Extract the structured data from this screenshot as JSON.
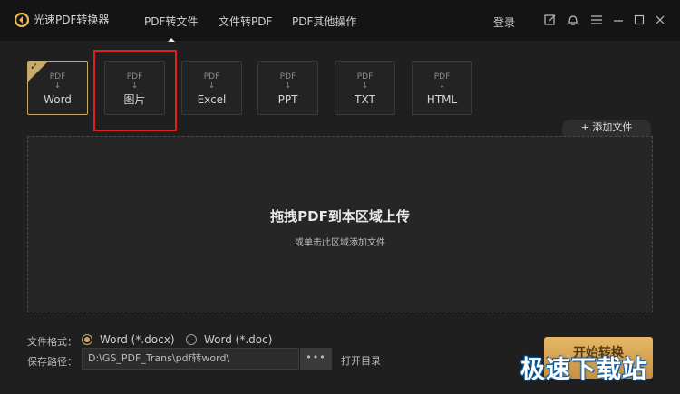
{
  "app": {
    "title": "光速PDF转换器",
    "colors": {
      "accent": "#c9a969",
      "background": "#1f1f1f",
      "titlebar": "#141414",
      "highlight": "#e02020",
      "start": "#e6b766"
    }
  },
  "nav": {
    "tabs": [
      {
        "label": "PDF转文件",
        "active": true
      },
      {
        "label": "文件转PDF",
        "active": false
      },
      {
        "label": "PDF其他操作",
        "active": false
      }
    ],
    "login": "登录"
  },
  "window_icons": [
    "edit-icon",
    "bell-icon",
    "menu-icon",
    "minimize-icon",
    "maximize-icon",
    "close-icon"
  ],
  "formats": {
    "source": "PDF",
    "arrow": "↓",
    "items": [
      {
        "label": "Word",
        "selected": true
      },
      {
        "label": "图片",
        "selected": false
      },
      {
        "label": "Excel",
        "selected": false
      },
      {
        "label": "PPT",
        "selected": false
      },
      {
        "label": "TXT",
        "selected": false
      },
      {
        "label": "HTML",
        "selected": false
      }
    ]
  },
  "add_file": "+ 添加文件",
  "dropzone": {
    "title": "拖拽PDF到本区域上传",
    "subtitle": "或单击此区域添加文件"
  },
  "options": {
    "format_label": "文件格式：",
    "radio_docx": "Word (*.docx)",
    "radio_doc": "Word (*.doc)",
    "selected": "docx",
    "path_label": "保存路径：",
    "path_value": "D:\\GS_PDF_Trans\\pdf转word\\",
    "browse": "•••",
    "open_dir": "打开目录"
  },
  "start_button": "开始转换",
  "watermark": "极速下载站"
}
